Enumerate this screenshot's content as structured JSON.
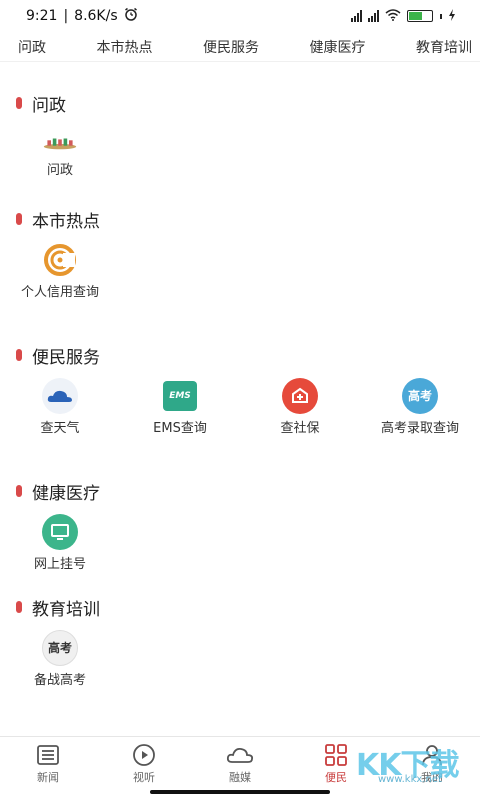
{
  "status_bar": {
    "time": "9:21",
    "speed": "8.6K/s",
    "battery": "60"
  },
  "category_tabs": [
    "问政",
    "本市热点",
    "便民服务",
    "健康医疗",
    "教育培训"
  ],
  "sections": [
    {
      "title": "问政",
      "items": [
        {
          "label": "问政",
          "icon": "government-icon"
        }
      ]
    },
    {
      "title": "本市热点",
      "items": [
        {
          "label": "个人信用查询",
          "icon": "credit-check-icon"
        }
      ]
    },
    {
      "title": "便民服务",
      "items": [
        {
          "label": "查天气",
          "icon": "weather-cloud-icon"
        },
        {
          "label": "EMS查询",
          "icon": "ems-icon",
          "icon_text": "EMS"
        },
        {
          "label": "查社保",
          "icon": "social-security-icon"
        },
        {
          "label": "高考录取查询",
          "icon": "gaokao-icon",
          "icon_text": "高考"
        }
      ]
    },
    {
      "title": "健康医疗",
      "items": [
        {
          "label": "网上挂号",
          "icon": "monitor-icon"
        }
      ]
    },
    {
      "title": "教育培训",
      "items": [
        {
          "label": "备战高考",
          "icon": "exam-prep-icon",
          "icon_text": "高考"
        }
      ]
    }
  ],
  "bottom_nav": [
    {
      "label": "新闻",
      "icon": "list-icon",
      "active": false
    },
    {
      "label": "视听",
      "icon": "play-icon",
      "active": false
    },
    {
      "label": "融媒",
      "icon": "cloud-icon",
      "active": false
    },
    {
      "label": "便民",
      "icon": "grid-icon",
      "active": true
    },
    {
      "label": "我的",
      "icon": "user-icon",
      "active": false
    }
  ],
  "watermark": {
    "text": "KK下载",
    "url": "www.kkx.net"
  },
  "colors": {
    "accent": "#c83c3c",
    "section_mark": "#d94a4a",
    "ems_green": "#2fa889",
    "social_red": "#e64a3b",
    "gaokao_blue": "#4aa8d8",
    "monitor_green": "#3cb58b"
  }
}
